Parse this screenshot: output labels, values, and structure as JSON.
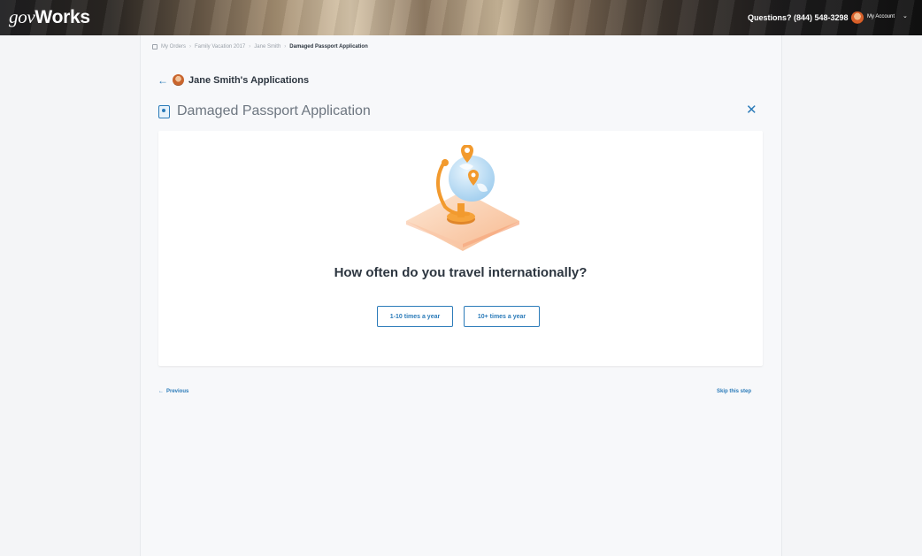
{
  "header": {
    "logo_gov": "gov",
    "logo_works": "Works",
    "questions": "Questions? (844) 548-3298",
    "account_label": "My Account",
    "account_chevron": "⌄"
  },
  "breadcrumb": {
    "items": [
      "My Orders",
      "Family Vacation 2017",
      "Jane Smith"
    ],
    "separator": "›",
    "current": "Damaged Passport Application"
  },
  "back": {
    "arrow": "←",
    "title": "Jane Smith's Applications"
  },
  "page": {
    "title": "Damaged Passport Application",
    "close": "✕"
  },
  "question": {
    "text": "How often do you travel internationally?",
    "options": [
      "1-10 times a year",
      "10+ times a year"
    ]
  },
  "footer": {
    "previous": "Previous",
    "previous_arrow": "←",
    "skip": "Skip this step"
  },
  "colors": {
    "accent": "#2b7bb9",
    "illustration_orange": "#f29a2e",
    "illustration_globe": "#bfe0f5"
  }
}
